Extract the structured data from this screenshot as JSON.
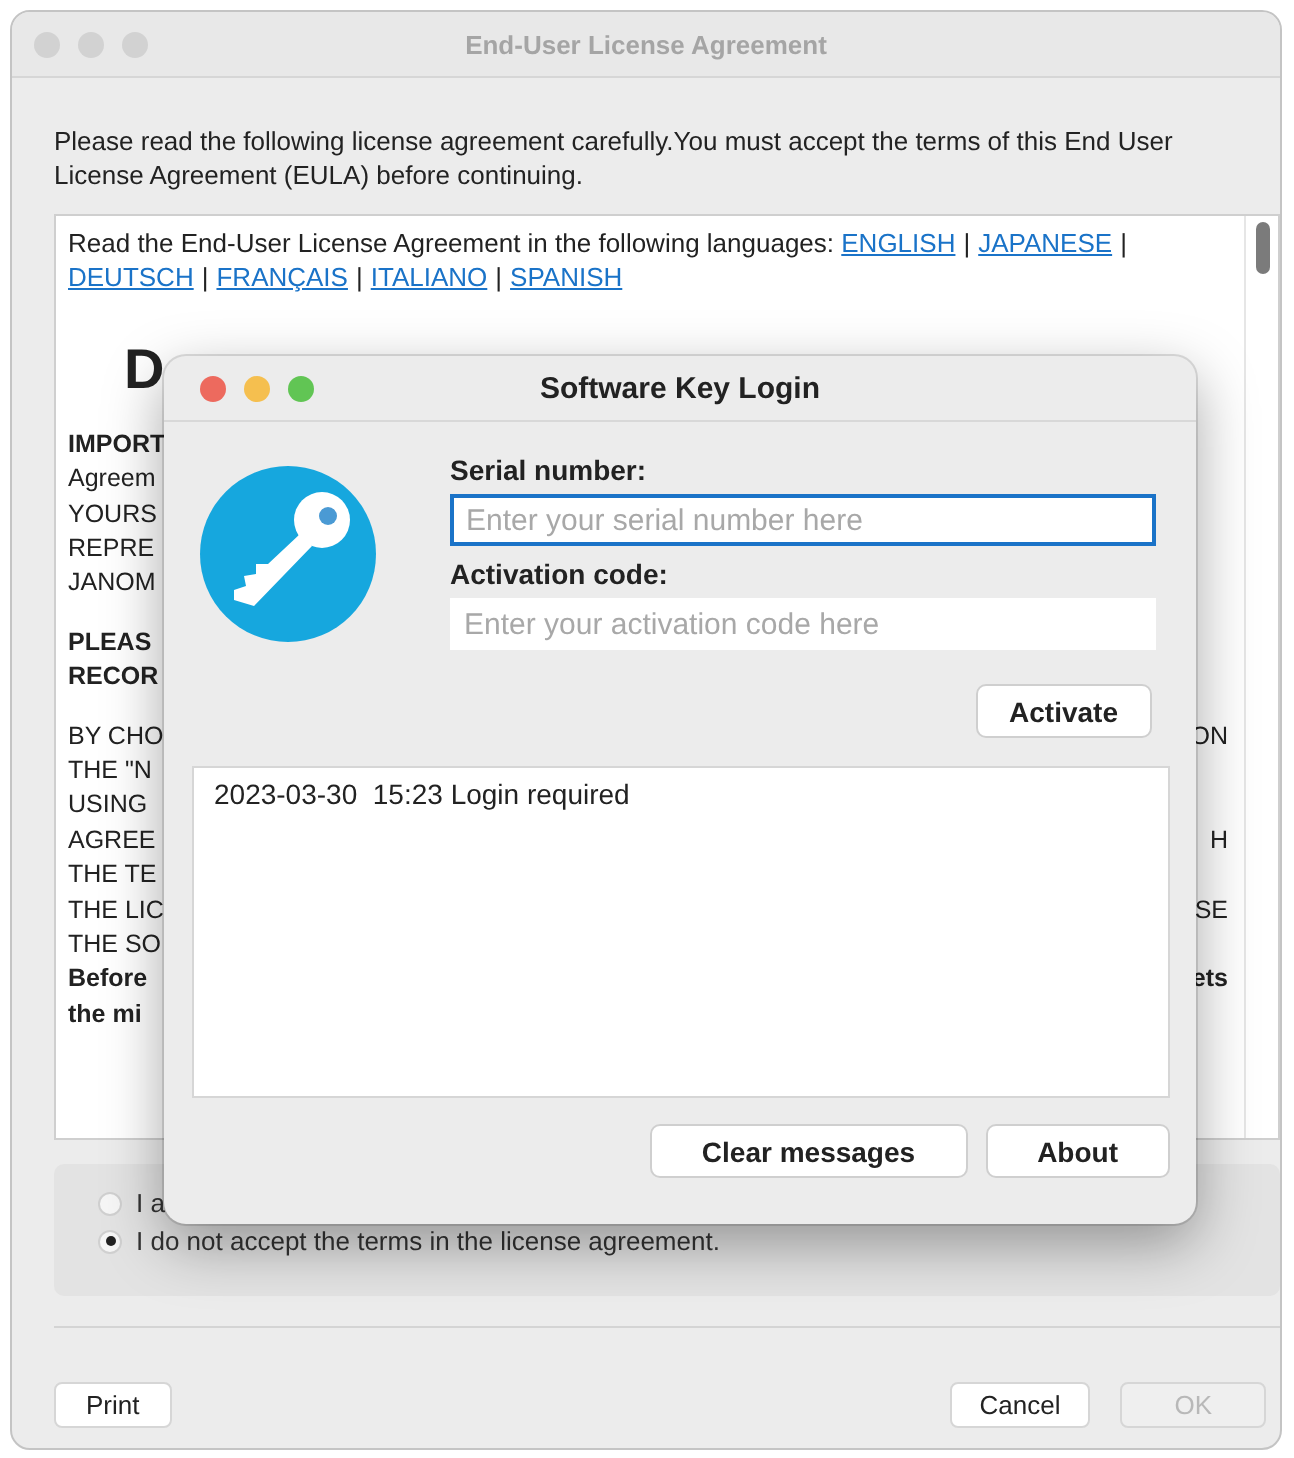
{
  "window": {
    "title": "End-User License Agreement"
  },
  "intro": "Please read the following license agreement carefully.You must accept the terms of this End User License Agreement (EULA) before continuing.",
  "eula": {
    "prompt": "Read the End-User License Agreement in the following languages:",
    "languages": [
      {
        "kind": "link",
        "text": "ENGLISH"
      },
      {
        "kind": "sep",
        "text": "|"
      },
      {
        "kind": "link",
        "text": "JAPANESE"
      },
      {
        "kind": "sep",
        "text": "|"
      },
      {
        "kind": "link",
        "text": "DEUTSCH"
      },
      {
        "kind": "sep",
        "text": "|"
      },
      {
        "kind": "link",
        "text": "FRANÇAIS"
      },
      {
        "kind": "sep",
        "text": "|"
      },
      {
        "kind": "link",
        "text": "ITALIANO"
      },
      {
        "kind": "sep",
        "text": "|"
      },
      {
        "kind": "link",
        "text": "SPANISH"
      }
    ],
    "heading": "D",
    "paragraphs": [
      [
        {
          "left": "IMPORT",
          "bold": true
        },
        {
          "left": "Agreem",
          "bold": false
        },
        {
          "left": "YOURS",
          "bold": false
        },
        {
          "left": "REPRE",
          "bold": false
        },
        {
          "left": "JANOM",
          "bold": false
        }
      ],
      [
        {
          "left": "PLEAS",
          "bold": true
        },
        {
          "left": "RECOR",
          "bold": true
        }
      ],
      [
        {
          "left": "BY CHO",
          "right": "ON",
          "bold": false
        },
        {
          "left": "THE \"N",
          "bold": false
        },
        {
          "left": "USING",
          "bold": false
        },
        {
          "left": "AGREE",
          "right": "H",
          "bold": false
        },
        {
          "left": "THE TE",
          "bold": false
        },
        {
          "left": "THE LIC",
          "right": "SE",
          "bold": false
        },
        {
          "left": "THE SO",
          "bold": false
        },
        {
          "left": "Before",
          "right": "ets",
          "bold": true
        },
        {
          "left": "the mi",
          "bold": true
        }
      ]
    ]
  },
  "radios": [
    {
      "label": "I a",
      "selected": false
    },
    {
      "label": "I do not accept the terms in the license agreement.",
      "selected": true
    }
  ],
  "buttons": [
    {
      "label": "Print",
      "disabled": false
    },
    {
      "label": "Cancel",
      "disabled": false
    },
    {
      "label": "OK",
      "disabled": true
    }
  ],
  "dialog": {
    "title": "Software Key Login",
    "fields": [
      {
        "label": "Serial number:",
        "placeholder": "Enter your serial number here",
        "focused": true
      },
      {
        "label": "Activation code:",
        "placeholder": "Enter your activation code here",
        "focused": false
      }
    ],
    "activate": "Activate",
    "messages": [
      "2023-03-30  15:23 Login required"
    ],
    "buttons": [
      "Clear messages",
      "About"
    ]
  }
}
